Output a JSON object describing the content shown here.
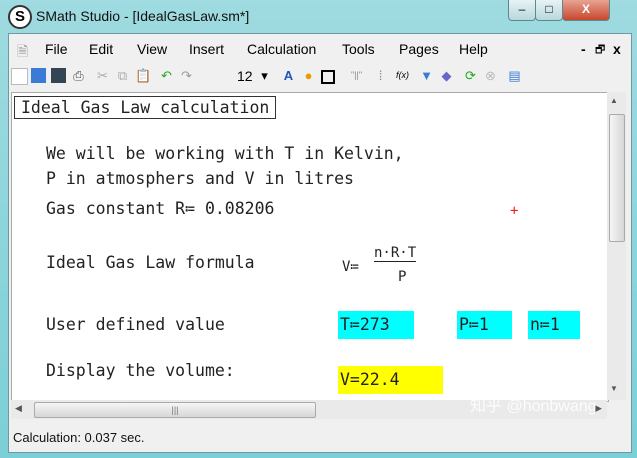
{
  "window": {
    "title": "SMath Studio - [IdealGasLaw.sm*]",
    "min": "–",
    "max": "□",
    "close": "X"
  },
  "menu": [
    "File",
    "Edit",
    "View",
    "Insert",
    "Calculation",
    "Tools",
    "Pages",
    "Help"
  ],
  "mdi": {
    "min": "-",
    "restore": "🗗",
    "close": "x"
  },
  "toolbar": {
    "font_size": "12",
    "fx": "f(x)"
  },
  "document": {
    "title_box": "Ideal Gas Law calculation",
    "line1": "We will be working with T in Kelvin,",
    "line2": "P in atmosphers and V in litres",
    "line3": "Gas constant R≔ 0.08206",
    "formula_label": "Ideal Gas Law formula",
    "formula_lhs": "V≔",
    "formula_num": "n·R·T",
    "formula_den": "P",
    "user_label": "User defined value",
    "inputs": [
      "T≔273",
      "P≔1",
      "n≔1"
    ],
    "display_label": "Display the volume:",
    "result": "V=22.4",
    "input_color": "#00ffff",
    "result_color": "#ffff00"
  },
  "status": "Calculation: 0.037 sec.",
  "watermark": "知乎 @honbwang"
}
